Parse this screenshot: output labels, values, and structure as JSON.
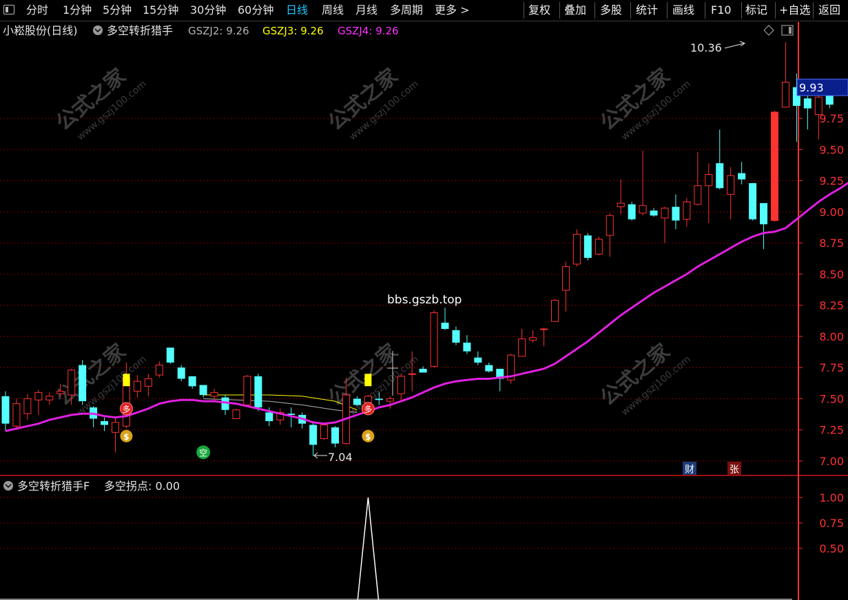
{
  "toolbar": {
    "left_items": [
      "分时",
      "1分钟",
      "5分钟",
      "15分钟",
      "30分钟",
      "60分钟",
      "日线",
      "周线",
      "月线",
      "多周期",
      "更多 >"
    ],
    "active_item": "日线",
    "right_items": [
      "复权",
      "叠加",
      "多股",
      "统计",
      "画线",
      "F10",
      "标记",
      "+自选",
      "返回"
    ]
  },
  "main_panel": {
    "stock_title": "小崧股份(日线)",
    "indicator_name": "多空转折猎手",
    "legend": [
      {
        "label": "GSZJ2: 9.26",
        "color": "#b4b4b4"
      },
      {
        "label": "GSZJ3: 9.26",
        "color": "#ffff00"
      },
      {
        "label": "GSZJ4: 9.26",
        "color": "#ff33ff"
      }
    ],
    "watermark_url": "bbs.gszb.top",
    "high_label": "10.36",
    "low_label": "7.04",
    "current_price": "9.93",
    "badge_cai": "财",
    "badge_zhang": "张",
    "signal_duo": "多",
    "signal_kong": "空",
    "watermark_cn": "公式之家",
    "watermark_site": "www.gszj100.com"
  },
  "sub_panel": {
    "title": "多空转折猎手F",
    "value_label": "多空拐点: 0.00"
  },
  "colors": {
    "up": "#ff3232",
    "down": "#54ffff",
    "ma": "#e020e0",
    "yellow": "#ffff00",
    "gray": "#b4b4b4",
    "grid": "#7a0000",
    "axis": "#ff3232",
    "price_box": "#0a1e8c"
  },
  "chart_data": [
    {
      "type": "candlestick",
      "ylim": [
        6.93,
        10.45
      ],
      "y_ticks": [
        7.0,
        7.25,
        7.5,
        7.75,
        8.0,
        8.25,
        8.5,
        8.75,
        9.0,
        9.25,
        9.5,
        9.75
      ],
      "candles": [
        {
          "o": 7.52,
          "h": 7.56,
          "l": 7.24,
          "c": 7.3
        },
        {
          "o": 7.28,
          "h": 7.5,
          "l": 7.25,
          "c": 7.46
        },
        {
          "o": 7.38,
          "h": 7.54,
          "l": 7.33,
          "c": 7.5
        },
        {
          "o": 7.49,
          "h": 7.57,
          "l": 7.37,
          "c": 7.55
        },
        {
          "o": 7.49,
          "h": 7.55,
          "l": 7.45,
          "c": 7.52
        },
        {
          "o": 7.54,
          "h": 7.62,
          "l": 7.52,
          "c": 7.56
        },
        {
          "o": 7.53,
          "h": 7.74,
          "l": 7.45,
          "c": 7.73
        },
        {
          "o": 7.77,
          "h": 7.81,
          "l": 7.45,
          "c": 7.48
        },
        {
          "o": 7.43,
          "h": 7.44,
          "l": 7.27,
          "c": 7.34
        },
        {
          "o": 7.32,
          "h": 7.35,
          "l": 7.24,
          "c": 7.29
        },
        {
          "o": 7.23,
          "h": 7.35,
          "l": 7.07,
          "c": 7.31
        },
        {
          "o": 7.28,
          "h": 7.79,
          "l": 7.26,
          "c": 7.67
        },
        {
          "o": 7.56,
          "h": 7.69,
          "l": 7.51,
          "c": 7.64
        },
        {
          "o": 7.6,
          "h": 7.7,
          "l": 7.52,
          "c": 7.66
        },
        {
          "o": 7.69,
          "h": 7.8,
          "l": 7.67,
          "c": 7.77
        },
        {
          "o": 7.91,
          "h": 7.91,
          "l": 7.78,
          "c": 7.79
        },
        {
          "o": 7.75,
          "h": 7.77,
          "l": 7.64,
          "c": 7.66
        },
        {
          "o": 7.68,
          "h": 7.68,
          "l": 7.58,
          "c": 7.6
        },
        {
          "o": 7.61,
          "h": 7.61,
          "l": 7.51,
          "c": 7.53
        },
        {
          "o": 7.52,
          "h": 7.58,
          "l": 7.47,
          "c": 7.55
        },
        {
          "o": 7.51,
          "h": 7.53,
          "l": 7.37,
          "c": 7.41
        },
        {
          "o": 7.34,
          "h": 7.42,
          "l": 7.34,
          "c": 7.41
        },
        {
          "o": 7.45,
          "h": 7.69,
          "l": 7.44,
          "c": 7.68
        },
        {
          "o": 7.68,
          "h": 7.7,
          "l": 7.4,
          "c": 7.43
        },
        {
          "o": 7.39,
          "h": 7.43,
          "l": 7.28,
          "c": 7.32
        },
        {
          "o": 7.33,
          "h": 7.42,
          "l": 7.29,
          "c": 7.39
        },
        {
          "o": 7.38,
          "h": 7.43,
          "l": 7.27,
          "c": 7.37
        },
        {
          "o": 7.37,
          "h": 7.39,
          "l": 7.26,
          "c": 7.3
        },
        {
          "o": 7.29,
          "h": 7.32,
          "l": 7.04,
          "c": 7.13
        },
        {
          "o": 7.18,
          "h": 7.3,
          "l": 7.17,
          "c": 7.29
        },
        {
          "o": 7.27,
          "h": 7.28,
          "l": 7.11,
          "c": 7.14
        },
        {
          "o": 7.14,
          "h": 7.67,
          "l": 7.13,
          "c": 7.53
        },
        {
          "o": 7.5,
          "h": 7.52,
          "l": 7.44,
          "c": 7.45
        },
        {
          "o": 7.47,
          "h": 7.53,
          "l": 7.44,
          "c": 7.52
        },
        {
          "o": 7.5,
          "h": 7.55,
          "l": 7.45,
          "c": 7.49
        },
        {
          "o": 7.48,
          "h": 7.52,
          "l": 7.42,
          "c": 7.5
        },
        {
          "o": 7.54,
          "h": 7.7,
          "l": 7.49,
          "c": 7.68
        },
        {
          "o": 7.7,
          "h": 7.88,
          "l": 7.56,
          "c": 7.7
        },
        {
          "o": 7.74,
          "h": 7.76,
          "l": 7.71,
          "c": 7.71
        },
        {
          "o": 7.76,
          "h": 8.21,
          "l": 7.75,
          "c": 8.19
        },
        {
          "o": 8.11,
          "h": 8.23,
          "l": 8.05,
          "c": 8.06
        },
        {
          "o": 8.05,
          "h": 8.08,
          "l": 7.93,
          "c": 7.95
        },
        {
          "o": 7.95,
          "h": 8.01,
          "l": 7.86,
          "c": 7.88
        },
        {
          "o": 7.83,
          "h": 7.88,
          "l": 7.77,
          "c": 7.79
        },
        {
          "o": 7.77,
          "h": 7.79,
          "l": 7.71,
          "c": 7.72
        },
        {
          "o": 7.74,
          "h": 7.74,
          "l": 7.56,
          "c": 7.66
        },
        {
          "o": 7.65,
          "h": 7.86,
          "l": 7.62,
          "c": 7.85
        },
        {
          "o": 7.84,
          "h": 8.06,
          "l": 7.84,
          "c": 7.98
        },
        {
          "o": 7.97,
          "h": 8.05,
          "l": 7.95,
          "c": 7.99
        },
        {
          "o": 8.06,
          "h": 8.07,
          "l": 7.92,
          "c": 8.06
        },
        {
          "o": 8.12,
          "h": 8.3,
          "l": 8.12,
          "c": 8.29
        },
        {
          "o": 8.37,
          "h": 8.6,
          "l": 8.2,
          "c": 8.56
        },
        {
          "o": 8.58,
          "h": 8.86,
          "l": 8.56,
          "c": 8.82
        },
        {
          "o": 8.81,
          "h": 8.83,
          "l": 8.61,
          "c": 8.63
        },
        {
          "o": 8.66,
          "h": 8.8,
          "l": 8.65,
          "c": 8.78
        },
        {
          "o": 8.81,
          "h": 8.99,
          "l": 8.64,
          "c": 8.97
        },
        {
          "o": 9.04,
          "h": 9.26,
          "l": 8.98,
          "c": 9.07
        },
        {
          "o": 9.06,
          "h": 9.08,
          "l": 8.93,
          "c": 8.94
        },
        {
          "o": 8.99,
          "h": 9.49,
          "l": 8.97,
          "c": 9.05
        },
        {
          "o": 9.01,
          "h": 9.03,
          "l": 8.96,
          "c": 8.97
        },
        {
          "o": 8.95,
          "h": 9.04,
          "l": 8.75,
          "c": 9.03
        },
        {
          "o": 9.04,
          "h": 9.14,
          "l": 8.86,
          "c": 8.93
        },
        {
          "o": 8.94,
          "h": 9.11,
          "l": 8.88,
          "c": 9.08
        },
        {
          "o": 9.06,
          "h": 9.48,
          "l": 9.05,
          "c": 9.21
        },
        {
          "o": 9.21,
          "h": 9.39,
          "l": 8.91,
          "c": 9.3
        },
        {
          "o": 9.39,
          "h": 9.66,
          "l": 9.18,
          "c": 9.19
        },
        {
          "o": 9.14,
          "h": 9.36,
          "l": 8.94,
          "c": 9.29
        },
        {
          "o": 9.31,
          "h": 9.4,
          "l": 9.22,
          "c": 9.26
        },
        {
          "o": 9.23,
          "h": 9.23,
          "l": 8.93,
          "c": 8.94
        },
        {
          "o": 9.07,
          "h": 9.07,
          "l": 8.7,
          "c": 8.9
        },
        {
          "o": 8.93,
          "h": 9.81,
          "l": 8.92,
          "c": 9.8
        },
        {
          "o": 9.84,
          "h": 10.36,
          "l": 9.84,
          "c": 10.04
        },
        {
          "o": 10.0,
          "h": 10.11,
          "l": 9.56,
          "c": 9.85
        },
        {
          "o": 9.91,
          "h": 9.99,
          "l": 9.66,
          "c": 9.83
        },
        {
          "o": 9.78,
          "h": 10.03,
          "l": 9.58,
          "c": 9.92
        },
        {
          "o": 9.93,
          "h": 10.0,
          "l": 9.83,
          "c": 9.86
        }
      ],
      "ma_line": [
        7.24,
        7.26,
        7.28,
        7.3,
        7.33,
        7.35,
        7.37,
        7.38,
        7.38,
        7.36,
        7.35,
        7.36,
        7.39,
        7.42,
        7.46,
        7.48,
        7.49,
        7.49,
        7.48,
        7.48,
        7.47,
        7.46,
        7.44,
        7.42,
        7.4,
        7.38,
        7.36,
        7.34,
        7.31,
        7.3,
        7.31,
        7.34,
        7.37,
        7.4,
        7.43,
        7.45,
        7.48,
        7.51,
        7.55,
        7.59,
        7.62,
        7.64,
        7.65,
        7.66,
        7.66,
        7.67,
        7.68,
        7.7,
        7.72,
        7.74,
        7.78,
        7.84,
        7.9,
        7.96,
        8.03,
        8.1,
        8.17,
        8.23,
        8.29,
        8.35,
        8.4,
        8.45,
        8.5,
        8.56,
        8.61,
        8.66,
        8.71,
        8.76,
        8.8,
        8.83,
        8.84,
        8.87,
        8.94,
        9.01,
        9.08,
        9.14,
        9.19,
        9.25
      ],
      "gszj2_line": [
        {
          "i": 18,
          "v": 7.5
        },
        {
          "i": 21,
          "v": 7.49
        },
        {
          "i": 24,
          "v": 7.48
        },
        {
          "i": 27,
          "v": 7.45
        },
        {
          "i": 30,
          "v": 7.41
        },
        {
          "i": 32,
          "v": 7.39
        }
      ],
      "gszj3_line": [
        {
          "i": 18,
          "v": 7.53
        },
        {
          "i": 21,
          "v": 7.53
        },
        {
          "i": 24,
          "v": 7.53
        },
        {
          "i": 27,
          "v": 7.52
        },
        {
          "i": 30,
          "v": 7.48
        },
        {
          "i": 32,
          "v": 7.41
        }
      ],
      "signals": [
        {
          "i": 11,
          "type": "duo"
        },
        {
          "i": 11,
          "type": "money"
        },
        {
          "i": 18,
          "type": "kong"
        },
        {
          "i": 33,
          "type": "duo"
        },
        {
          "i": 33,
          "type": "money"
        }
      ],
      "yellow_marks": [
        11,
        33
      ]
    },
    {
      "type": "line",
      "name": "多空拐点",
      "ylim": [
        0.1,
        1.1
      ],
      "y_ticks": [
        0.5,
        0.75,
        1.0
      ],
      "values_nonzero": [
        {
          "i": 33,
          "v": 1.0
        }
      ]
    }
  ]
}
